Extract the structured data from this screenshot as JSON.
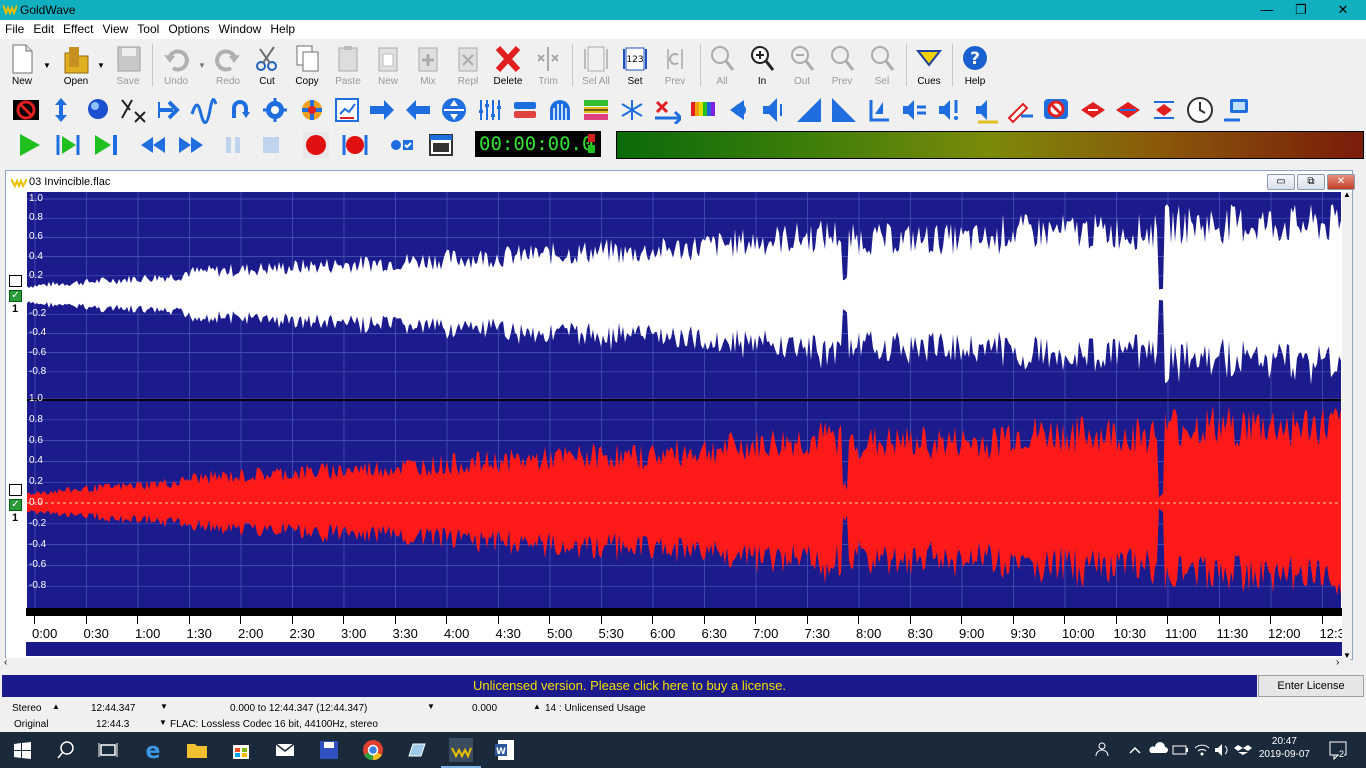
{
  "app": {
    "title": "GoldWave"
  },
  "window_controls": {
    "minimize": "—",
    "maximize": "❐",
    "close": "✕"
  },
  "menu": [
    "File",
    "Edit",
    "Effect",
    "View",
    "Tool",
    "Options",
    "Window",
    "Help"
  ],
  "toolbar": {
    "new": "New",
    "open": "Open",
    "save": "Save",
    "undo": "Undo",
    "redo": "Redo",
    "cut": "Cut",
    "copy": "Copy",
    "paste": "Paste",
    "paste_new": "New",
    "mix": "Mix",
    "replace": "Repl",
    "delete": "Delete",
    "trim": "Trim",
    "select_all": "Sel All",
    "set": "Set",
    "prev": "Prev",
    "zoom_all": "All",
    "zoom_in": "In",
    "zoom_out": "Out",
    "zoom_prev": "Prev",
    "zoom_sel": "Sel",
    "cues": "Cues",
    "help": "Help"
  },
  "transport": {
    "time": "00:00:00.0"
  },
  "document": {
    "title": "03 Invincible.flac",
    "controls": {
      "min": "▭",
      "restore": "⧉",
      "close": "✕"
    },
    "channel_numbers": [
      "1",
      "1"
    ],
    "y_ticks": [
      "1.0",
      "0.8",
      "0.6",
      "0.4",
      "0.2",
      "0.0",
      "-0.2",
      "-0.4",
      "-0.6",
      "-0.8"
    ],
    "timeline": [
      "0:00",
      "0:30",
      "1:00",
      "1:30",
      "2:00",
      "2:30",
      "3:00",
      "3:30",
      "4:00",
      "4:30",
      "5:00",
      "5:30",
      "6:00",
      "6:30",
      "7:00",
      "7:30",
      "8:00",
      "8:30",
      "9:00",
      "9:30",
      "10:00",
      "10:30",
      "11:00",
      "11:30",
      "12:00",
      "12:3"
    ]
  },
  "license": {
    "banner": "Unlicensed version. Please click here to buy a license.",
    "button": "Enter License"
  },
  "status": {
    "row1": {
      "channels": "Stereo",
      "length": "12:44.347",
      "selection": "0.000 to 12:44.347 (12:44.347)",
      "position": "0.000",
      "usage": "14 : Unlicensed Usage"
    },
    "row2": {
      "mode": "Original",
      "length": "12:44.3",
      "format": "FLAC: Lossless Codec 16 bit, 44100Hz, stereo"
    }
  },
  "taskbar": {
    "time": "20:47",
    "date": "2019-09-07",
    "notifications": "2"
  },
  "colors": {
    "wave_bg": "#1b1b8e",
    "left_wave": "#ffffff",
    "right_wave": "#ff1a1a",
    "titlebar": "#10b0c0",
    "license_text": "#f4e000"
  }
}
